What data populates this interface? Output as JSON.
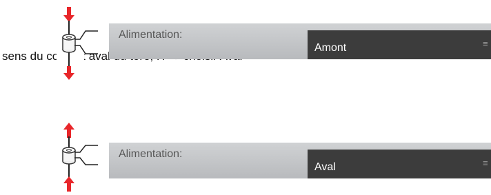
{
  "document": {
    "caption": "sens du courant aval du tore, H → choisir Aval"
  },
  "panels": [
    {
      "label": "Alimentation:",
      "select_value": "Amont",
      "arrow_direction": "down",
      "icon": "menu-lines-icon"
    },
    {
      "label": "Alimentation:",
      "select_value": "Aval",
      "arrow_direction": "up",
      "icon": "menu-lines-icon"
    }
  ],
  "colors": {
    "arrow": "#e8262a",
    "select_bg": "#3c3c3c",
    "panel_bg": "#c4c6c9"
  }
}
